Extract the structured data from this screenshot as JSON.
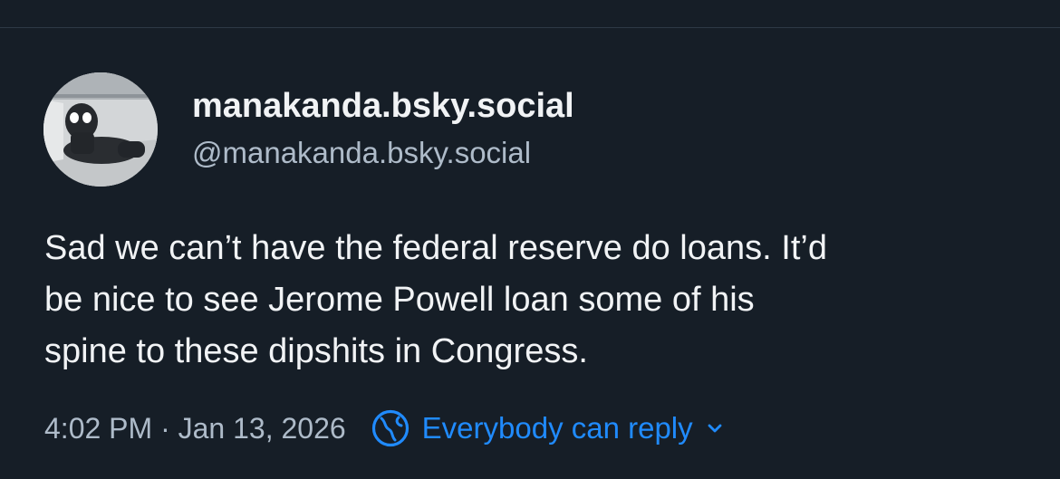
{
  "post": {
    "author": {
      "display_name": "manakanda.bsky.social",
      "handle": "@manakanda.bsky.social",
      "avatar_icon": "avatar-photo"
    },
    "text_lines": [
      "Sad we can’t have the federal reserve do loans. It’d",
      "be nice to see Jerome Powell loan some of his",
      "spine to these dipshits in Congress."
    ],
    "timestamp": "4:02 PM · Jan 13, 2026",
    "reply_setting": {
      "icon": "globe-icon",
      "label": "Everybody can reply",
      "chevron_icon": "chevron-down-icon"
    }
  },
  "colors": {
    "background": "#161e27",
    "primary_text": "#f1f3f5",
    "secondary_text": "#aebbc9",
    "accent": "#208bfe",
    "divider": "#2e3946"
  }
}
